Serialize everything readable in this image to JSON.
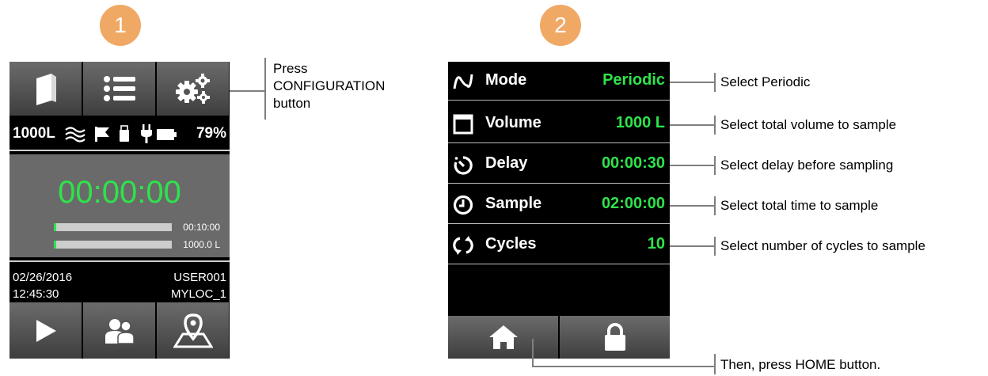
{
  "steps": {
    "step1": "1",
    "step2": "2"
  },
  "device1": {
    "toolbar": {
      "manual_icon": "book-icon",
      "list_icon": "list-icon",
      "config_icon": "gears-icon"
    },
    "status": {
      "volume": "1000L",
      "battery": "79%"
    },
    "timer": "00:00:00",
    "progress": [
      {
        "label": "00:10:00",
        "fraction": 0.01
      },
      {
        "label": "1000.0 L",
        "fraction": 0.01
      }
    ],
    "info": {
      "date": "02/26/2016",
      "time": "12:45:30",
      "user": "USER001",
      "location": "MYLOC_1"
    },
    "bottom": {
      "play_icon": "play-icon",
      "users_icon": "users-icon",
      "location_icon": "location-map-icon"
    }
  },
  "callout1": {
    "line1": "Press",
    "line2": "CONFIGURATION",
    "line3": "button"
  },
  "device2": {
    "rows": [
      {
        "label": "Mode",
        "value": "Periodic",
        "icon": "wave-icon"
      },
      {
        "label": "Volume",
        "value": "1000 L",
        "icon": "square-icon"
      },
      {
        "label": "Delay",
        "value": "00:00:30",
        "icon": "timer-icon"
      },
      {
        "label": "Sample",
        "value": "02:00:00",
        "icon": "clock-icon"
      },
      {
        "label": "Cycles",
        "value": "10",
        "icon": "cycle-icon"
      }
    ],
    "bottom": {
      "home_icon": "home-icon",
      "lock_icon": "lock-icon"
    }
  },
  "callouts2": [
    "Select Periodic",
    "Select total volume to sample",
    "Select delay before sampling",
    "Select total time to sample",
    "Select number of cycles to sample"
  ],
  "callout_home": "Then, press HOME button.",
  "colors": {
    "accent_green": "#2ee34a",
    "badge_orange": "#f0a865",
    "leader_gray": "#7f7f7f"
  }
}
